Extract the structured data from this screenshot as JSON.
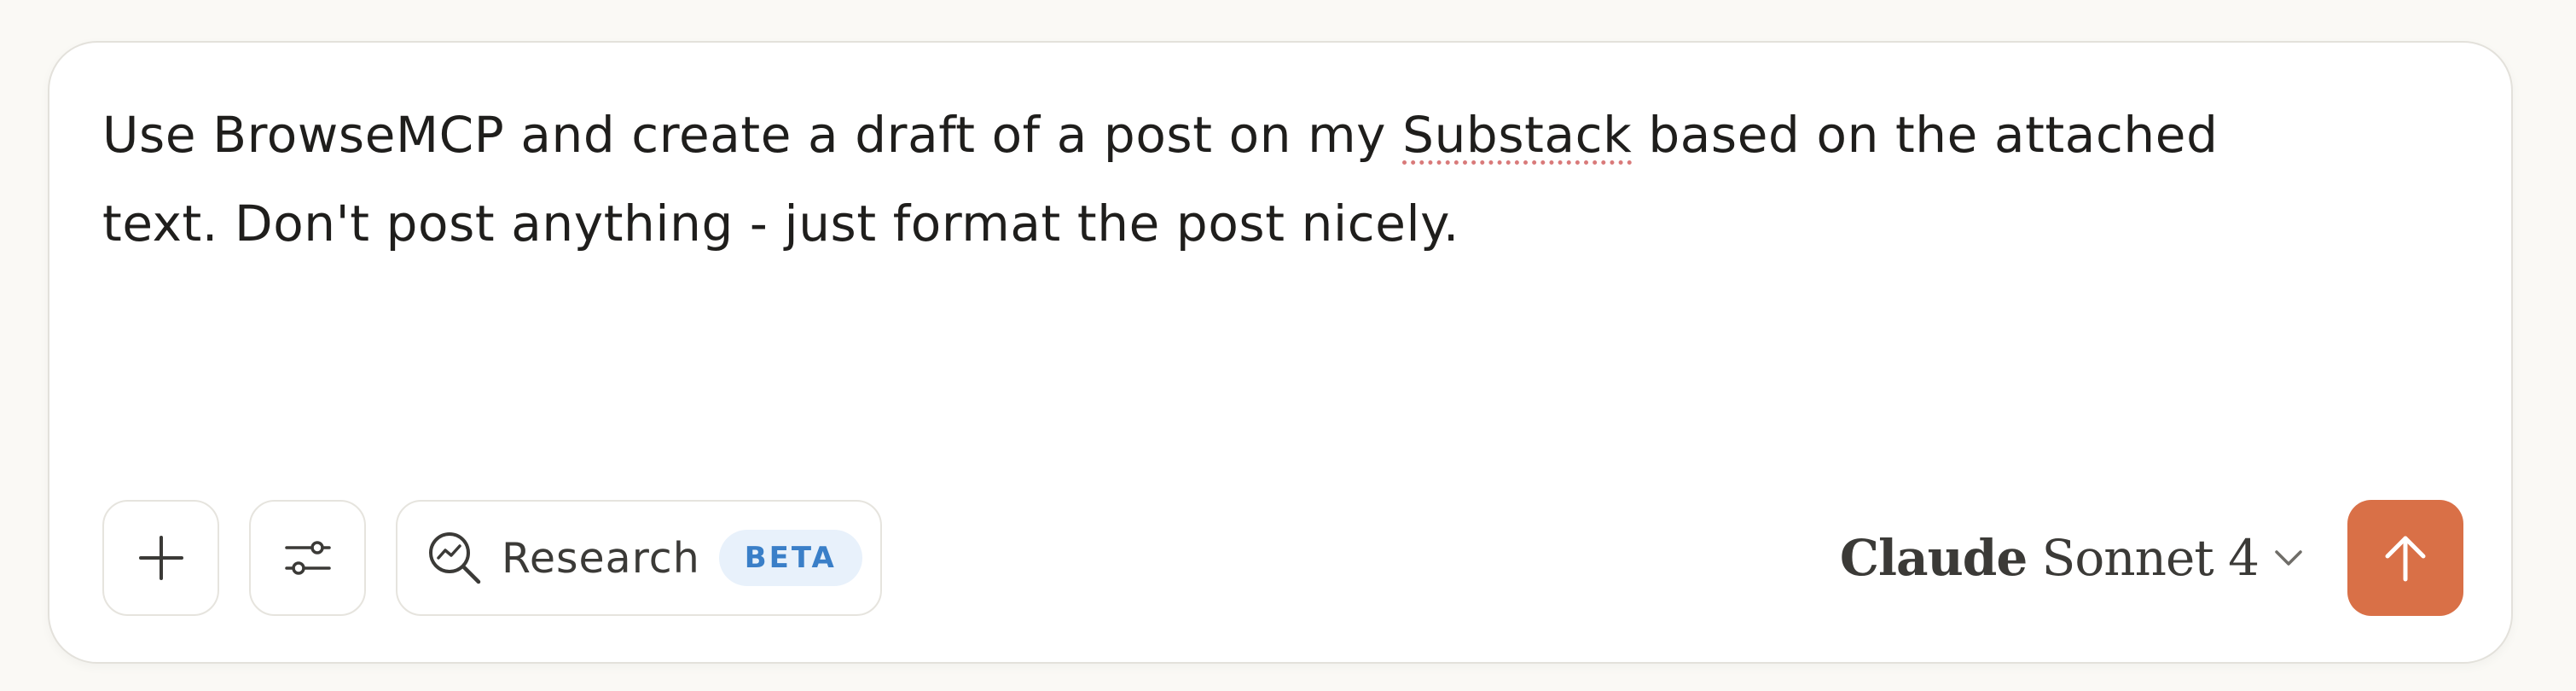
{
  "composer": {
    "prompt_line_1_before": "Use BrowseMCP and create a draft of a post on my ",
    "prompt_misspelled_word": "Substack",
    "prompt_line_1_after": " based on the attached",
    "prompt_line_2": "text. Don't post anything - just format the post nicely."
  },
  "toolbar": {
    "add_icon": "plus-icon",
    "tools_icon": "sliders-icon",
    "research_icon": "research-magnifier-icon",
    "research_label": "Research",
    "research_badge": "BETA"
  },
  "model_selector": {
    "brand": "Claude",
    "model": "Sonnet 4",
    "chevron_icon": "chevron-down-icon"
  },
  "send_button": {
    "icon": "arrow-up-icon",
    "color": "#d97047"
  },
  "colors": {
    "page_background": "#faf9f5",
    "composer_background": "#ffffff",
    "beta_badge_text": "#3a7fc8",
    "beta_badge_background": "#e8f1fb",
    "spellcheck_underline": "#d97a7a"
  }
}
